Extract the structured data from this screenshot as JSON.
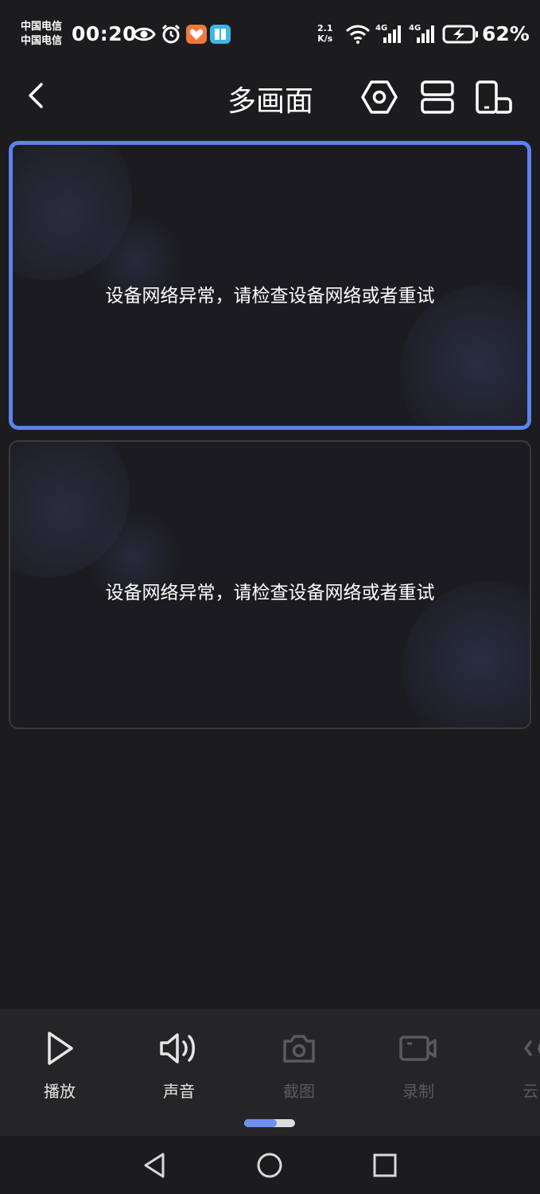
{
  "status_bar": {
    "carrier_1": "中国电信",
    "carrier_2": "中国电信",
    "time": "00:20",
    "net_speed_value": "2.1",
    "net_speed_unit": "K/s",
    "signal_1_label": "4G",
    "signal_2_label": "4G",
    "battery": "62%",
    "icons": [
      "eye-icon",
      "alarm-icon",
      "app-badge-orange",
      "app-badge-book",
      "wifi-icon",
      "signal-icon",
      "signal-icon",
      "battery-charging-icon"
    ]
  },
  "header": {
    "title": "多画面",
    "icons": [
      "back-arrow-icon",
      "settings-hexagon-icon",
      "split-layout-icon",
      "device-switch-icon"
    ]
  },
  "panels": [
    {
      "message": "设备网络异常，请检查设备网络或者重试",
      "selected": true
    },
    {
      "message": "设备网络异常，请检查设备网络或者重试",
      "selected": false
    }
  ],
  "toolbar": {
    "items": [
      {
        "label": "播放",
        "icon": "play-icon",
        "enabled": true
      },
      {
        "label": "声音",
        "icon": "speaker-icon",
        "enabled": true
      },
      {
        "label": "截图",
        "icon": "camera-icon",
        "enabled": false
      },
      {
        "label": "录制",
        "icon": "video-record-icon",
        "enabled": false
      },
      {
        "label": "云",
        "icon": "cloud-ptz-icon",
        "enabled": false
      }
    ],
    "page_indicator_progress": 0.64,
    "colors": {
      "accent": "#5b82ee",
      "disabled": "#5a5a5e"
    }
  },
  "nav_bar": {
    "icons": [
      "nav-back-icon",
      "nav-home-icon",
      "nav-recents-icon"
    ]
  }
}
